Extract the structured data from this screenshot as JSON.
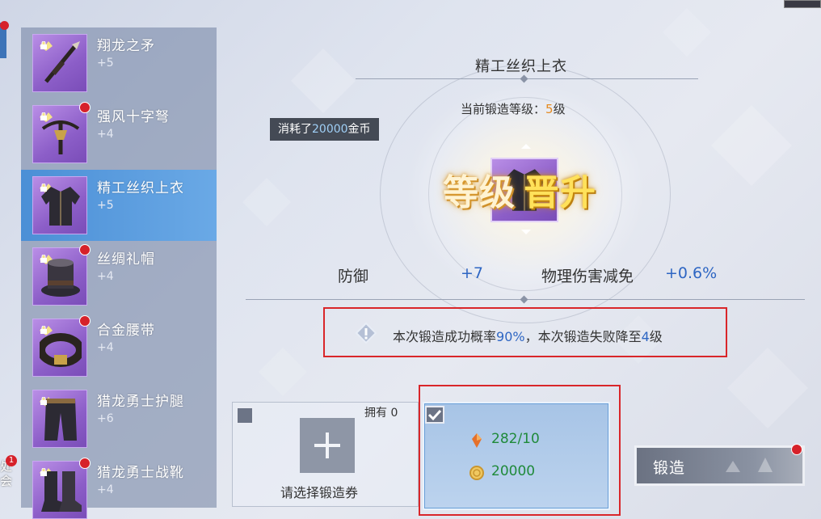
{
  "items": [
    {
      "name": "翔龙之矛",
      "plus": "+5",
      "icon": "spear-icon",
      "has_notice": false,
      "selected": false
    },
    {
      "name": "强风十字弩",
      "plus": "+4",
      "icon": "crossbow-icon",
      "has_notice": true,
      "selected": false
    },
    {
      "name": "精工丝织上衣",
      "plus": "+5",
      "icon": "jacket-icon",
      "has_notice": false,
      "selected": true
    },
    {
      "name": "丝绸礼帽",
      "plus": "+4",
      "icon": "top-hat-icon",
      "has_notice": true,
      "selected": false
    },
    {
      "name": "合金腰带",
      "plus": "+4",
      "icon": "belt-icon",
      "has_notice": true,
      "selected": false
    },
    {
      "name": "猎龙勇士护腿",
      "plus": "+6",
      "icon": "leggings-icon",
      "has_notice": false,
      "selected": false
    },
    {
      "name": "猎龙勇士战靴",
      "plus": "+4",
      "icon": "boots-icon",
      "has_notice": true,
      "selected": false
    }
  ],
  "edge": {
    "text": "处会",
    "badge": "1"
  },
  "forge": {
    "item_title": "精工丝织上衣",
    "level_prefix": "当前锻造等级：",
    "level_num": "5",
    "level_suffix": "级",
    "cost_prefix": "消耗了",
    "cost_amount": "20000",
    "cost_suffix": "金币",
    "levelup_a": "等级",
    "levelup_b": "晋升"
  },
  "stats": {
    "defense_label": "防御",
    "defense_value": "+7",
    "reduction_label": "物理伤害减免",
    "reduction_value": "+0.6%"
  },
  "warning": {
    "text_a": "本次锻造成功概率",
    "rate": "90%",
    "text_b": "，本次锻造失败降至",
    "fail_level": "4",
    "text_c": "级"
  },
  "ticket": {
    "owned": "拥有 0",
    "prompt": "请选择锻造券"
  },
  "materials": {
    "crystal": "282/10",
    "gold": "20000"
  },
  "forge_button": "锻造",
  "colors": {
    "accent_blue": "#2e66c3",
    "level_orange": "#e58a1f",
    "material_green": "#1f8a3a",
    "highlight_red": "#d9262a",
    "selected_row": "#4b8fd6"
  }
}
